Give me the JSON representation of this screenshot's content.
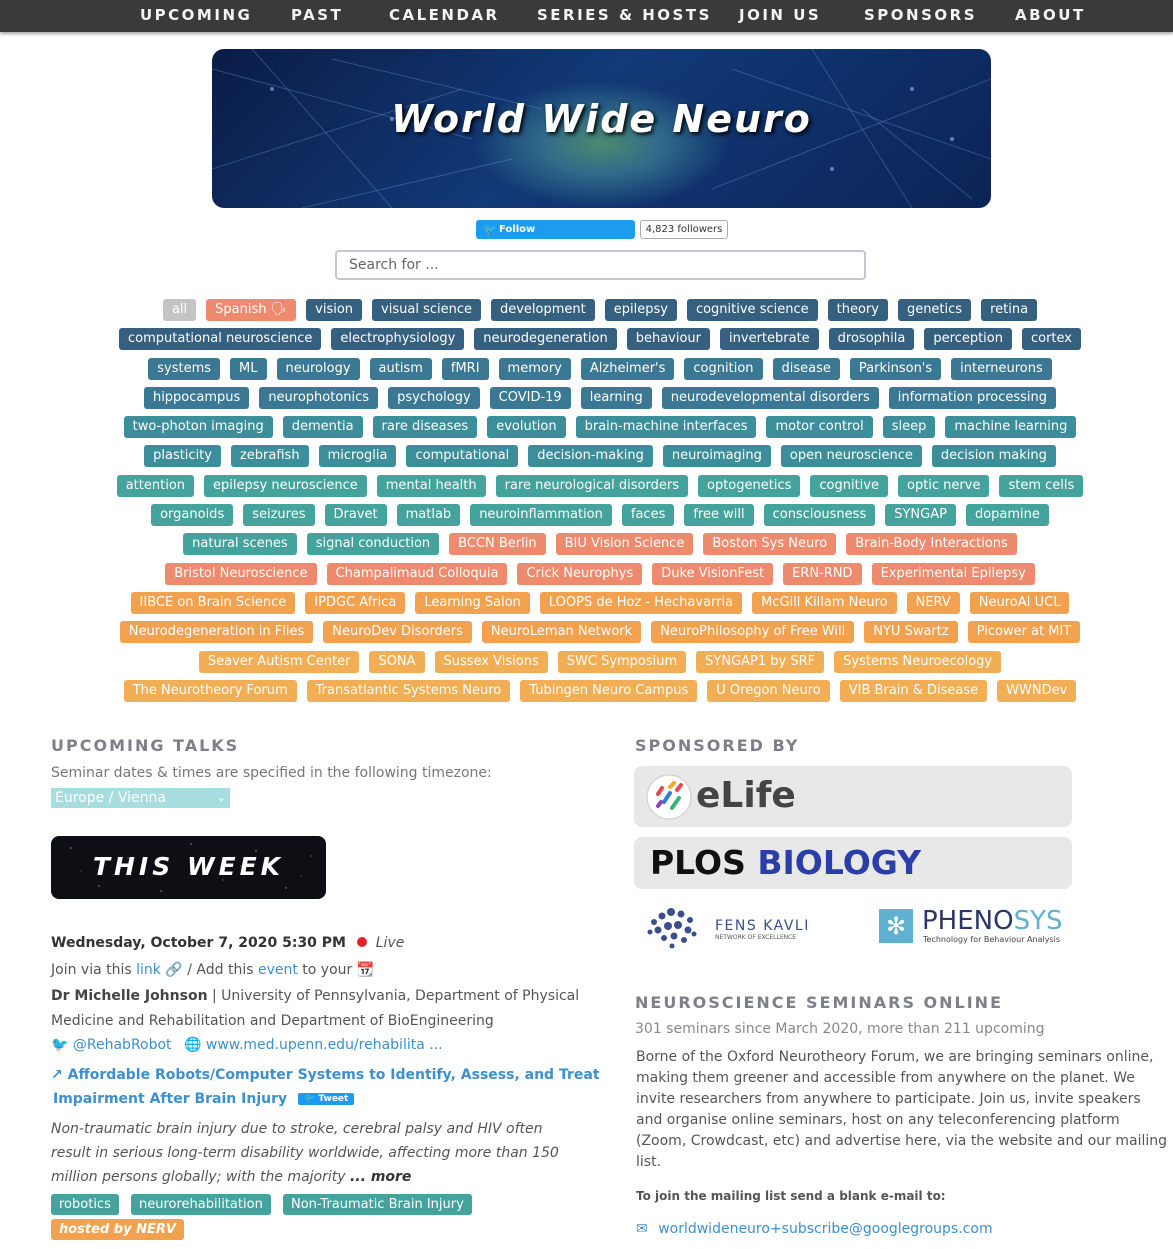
{
  "nav": [
    "UPCOMING",
    "PAST",
    "CALENDAR",
    "SERIES & HOSTS",
    "JOIN US",
    "SPONSORS",
    "ABOUT"
  ],
  "banner": {
    "title": "World Wide Neuro"
  },
  "twitter": {
    "follow": "Follow @worldwideneuro",
    "followers": "4,823 followers"
  },
  "search": {
    "placeholder": "Search for ..."
  },
  "tag_rows": [
    [
      [
        "all",
        "gray"
      ],
      [
        "Spanish 🗣",
        "salmon"
      ],
      [
        "vision",
        "navy"
      ],
      [
        "visual science",
        "navy"
      ],
      [
        "development",
        "navy"
      ],
      [
        "epilepsy",
        "navy"
      ],
      [
        "cognitive science",
        "navy"
      ],
      [
        "theory",
        "navy"
      ],
      [
        "genetics",
        "navy"
      ],
      [
        "retina",
        "navy"
      ]
    ],
    [
      [
        "computational neuroscience",
        "navy"
      ],
      [
        "electrophysiology",
        "navy"
      ],
      [
        "neurodegeneration",
        "navy"
      ],
      [
        "behaviour",
        "navy"
      ],
      [
        "invertebrate",
        "navy"
      ],
      [
        "drosophila",
        "navy"
      ],
      [
        "perception",
        "navy"
      ],
      [
        "cortex",
        "navy"
      ]
    ],
    [
      [
        "systems",
        "teal1"
      ],
      [
        "ML",
        "teal1"
      ],
      [
        "neurology",
        "teal1"
      ],
      [
        "autism",
        "teal1"
      ],
      [
        "fMRI",
        "teal1"
      ],
      [
        "memory",
        "teal1"
      ],
      [
        "Alzheimer's",
        "teal1"
      ],
      [
        "cognition",
        "teal1"
      ],
      [
        "disease",
        "teal1"
      ],
      [
        "Parkinson's",
        "teal1"
      ],
      [
        "interneurons",
        "teal1"
      ]
    ],
    [
      [
        "hippocampus",
        "teal1"
      ],
      [
        "neurophotonics",
        "teal1"
      ],
      [
        "psychology",
        "teal1"
      ],
      [
        "COVID-19",
        "teal1"
      ],
      [
        "learning",
        "teal1"
      ],
      [
        "neurodevelopmental disorders",
        "teal1"
      ],
      [
        "information processing",
        "teal1"
      ]
    ],
    [
      [
        "two-photon imaging",
        "teal2"
      ],
      [
        "dementia",
        "teal2"
      ],
      [
        "rare diseases",
        "teal2"
      ],
      [
        "evolution",
        "teal2"
      ],
      [
        "brain-machine interfaces",
        "teal2"
      ],
      [
        "motor control",
        "teal2"
      ],
      [
        "sleep",
        "teal2"
      ],
      [
        "machine learning",
        "teal2"
      ]
    ],
    [
      [
        "plasticity",
        "teal2"
      ],
      [
        "zebrafish",
        "teal2"
      ],
      [
        "microglia",
        "teal2"
      ],
      [
        "computational",
        "teal2"
      ],
      [
        "decision-making",
        "teal2"
      ],
      [
        "neuroimaging",
        "teal2"
      ],
      [
        "open neuroscience",
        "teal2"
      ],
      [
        "decision making",
        "teal2"
      ]
    ],
    [
      [
        "attention",
        "teal3"
      ],
      [
        "epilepsy neuroscience",
        "teal3"
      ],
      [
        "mental health",
        "teal3"
      ],
      [
        "rare neurological disorders",
        "teal3"
      ],
      [
        "optogenetics",
        "teal3"
      ],
      [
        "cognitive",
        "teal3"
      ],
      [
        "optic nerve",
        "teal3"
      ],
      [
        "stem cells",
        "teal3"
      ]
    ],
    [
      [
        "organoids",
        "teal3"
      ],
      [
        "seizures",
        "teal3"
      ],
      [
        "Dravet",
        "teal3"
      ],
      [
        "matlab",
        "teal3"
      ],
      [
        "neuroinflammation",
        "teal3"
      ],
      [
        "faces",
        "teal3"
      ],
      [
        "free will",
        "teal3"
      ],
      [
        "consciousness",
        "teal3"
      ],
      [
        "SYNGAP",
        "teal3"
      ],
      [
        "dopamine",
        "teal3"
      ]
    ],
    [
      [
        "natural scenes",
        "teal3"
      ],
      [
        "signal conduction",
        "teal3"
      ],
      [
        "BCCN Berlin",
        "salmon"
      ],
      [
        "BIU Vision Science",
        "salmon"
      ],
      [
        "Boston Sys Neuro",
        "salmon"
      ],
      [
        "Brain-Body Interactions",
        "salmon"
      ]
    ],
    [
      [
        "Bristol Neuroscience",
        "salmon"
      ],
      [
        "Champalimaud Colloquia",
        "salmon"
      ],
      [
        "Crick Neurophys",
        "salmon"
      ],
      [
        "Duke VisionFest",
        "salmon"
      ],
      [
        "ERN-RND",
        "salmon"
      ],
      [
        "Experimental Epilepsy",
        "salmon"
      ]
    ],
    [
      [
        "IIBCE on Brain Science",
        "orange"
      ],
      [
        "IPDGC Africa",
        "orange"
      ],
      [
        "Learning Salon",
        "orange"
      ],
      [
        "LOOPS de Hoz - Hechavarria",
        "orange"
      ],
      [
        "McGill Killam Neuro",
        "orange"
      ],
      [
        "NERV",
        "orange"
      ],
      [
        "NeuroAI UCL",
        "orange"
      ]
    ],
    [
      [
        "Neurodegeneration in Flies",
        "orange"
      ],
      [
        "NeuroDev Disorders",
        "orange"
      ],
      [
        "NeuroLeman Network",
        "orange"
      ],
      [
        "NeuroPhilosophy of Free Will",
        "orange"
      ],
      [
        "NYU Swartz",
        "orange"
      ],
      [
        "Picower at MIT",
        "orange"
      ]
    ],
    [
      [
        "Seaver Autism Center",
        "orange2"
      ],
      [
        "SONA",
        "orange2"
      ],
      [
        "Sussex Visions",
        "orange2"
      ],
      [
        "SWC Symposium",
        "orange2"
      ],
      [
        "SYNGAP1 by SRF",
        "orange2"
      ],
      [
        "Systems Neuroecology",
        "orange2"
      ]
    ],
    [
      [
        "The Neurotheory Forum",
        "orange2"
      ],
      [
        "Transatlantic Systems Neuro",
        "orange2"
      ],
      [
        "Tubingen Neuro Campus",
        "orange2"
      ],
      [
        "U Oregon Neuro",
        "orange2"
      ],
      [
        "VIB Brain & Disease",
        "orange2"
      ],
      [
        "WWNDev",
        "orange2"
      ]
    ]
  ],
  "upcoming": {
    "title": "UPCOMING TALKS",
    "tz_label": "Seminar dates & times are specified in the following timezone:",
    "tz_value": "Europe / Vienna",
    "this_week": "THIS WEEK",
    "talk": {
      "date": "Wednesday, October 7, 2020 5:30 PM",
      "live": "Live",
      "join_pre": "Join via this",
      "join_link": "link",
      "add_pre": "/ Add this",
      "add_link": "event",
      "add_post": "to your",
      "speaker": "Dr Michelle Johnson",
      "affil1": "| University of Pennsylvania, Department of Physical",
      "affil2": "Medicine and Rehabilitation and Department of BioEngineering",
      "handle": "@RehabRobot",
      "website": "www.med.upenn.edu/rehabilita ...",
      "title1": "Affordable Robots/Computer Systems to Identify, Assess, and Treat",
      "title2": "Impairment After Brain Injury",
      "tweet": "Tweet",
      "abstract1": "Non-traumatic brain injury due to stroke, cerebral palsy and HIV often",
      "abstract2": "result in serious long-term disability worldwide, affecting more than 150",
      "abstract3": "million persons globally; with the majority",
      "more": "... more",
      "tags": [
        "robotics",
        "neurorehabilitation",
        "Non-Traumatic Brain Injury"
      ],
      "hosted": "hosted by NERV"
    }
  },
  "sponsors": {
    "title": "SPONSORED BY",
    "elife": "eLife",
    "plos_a": "PLOS",
    "plos_b": "BIOLOGY",
    "fens1": "FENS KAVLI",
    "fens2": "NETWORK OF EXCELLENCE",
    "pheno1": "PHENO",
    "pheno2": "SYS",
    "pheno_tag": "Technology for Behaviour Analysis"
  },
  "about": {
    "title": "NEUROSCIENCE SEMINARS ONLINE",
    "subtitle": "301 seminars since March 2020, more than 211 upcoming",
    "p1": "Borne of the Oxford Neurotheory Forum, we are bringing seminars online,",
    "p2": "making them greener and accessible from anywhere on the planet. We",
    "p3": "invite researchers from anywhere to participate. Join us, invite speakers",
    "p4": "and organise online seminars, host on any teleconferencing platform",
    "p5": "(Zoom, Crowdcast, etc) and advertise here, via the website and our mailing",
    "p6": "list.",
    "mailing": "To join the mailing list send a blank e-mail to:",
    "email": "worldwideneuro+subscribe@googlegroups.com"
  }
}
